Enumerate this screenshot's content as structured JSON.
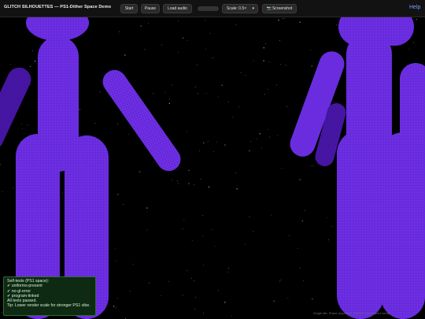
{
  "app": {
    "title": "GLITCH SILHOUETTES — PS1-Dither Space Demo"
  },
  "toolbar": {
    "start_label": "Start",
    "pause_label": "Pause",
    "load_audio_label": "Load audio",
    "audio_progress": 0,
    "scale_label": "Scale: 0.5×",
    "screenshot_label": "Screenshot",
    "help_label": "Help"
  },
  "colors": {
    "figure_purple": "#6a25d6",
    "figure_highlight": "#8a4cff",
    "toolbar_bg": "#121212",
    "panel_green": "#0e2a12"
  },
  "tests_panel": {
    "title": "Self-tests (PS1 space):",
    "items": [
      "✔ uniforms-present",
      "✔ no-gl-error",
      "✔ program-linked"
    ],
    "summary": "All tests passed.",
    "tip": "Tip: Lower render scale for stronger PS1 vibe."
  },
  "hint": "Single-file. Share anywhere. Edit the frag shader below."
}
